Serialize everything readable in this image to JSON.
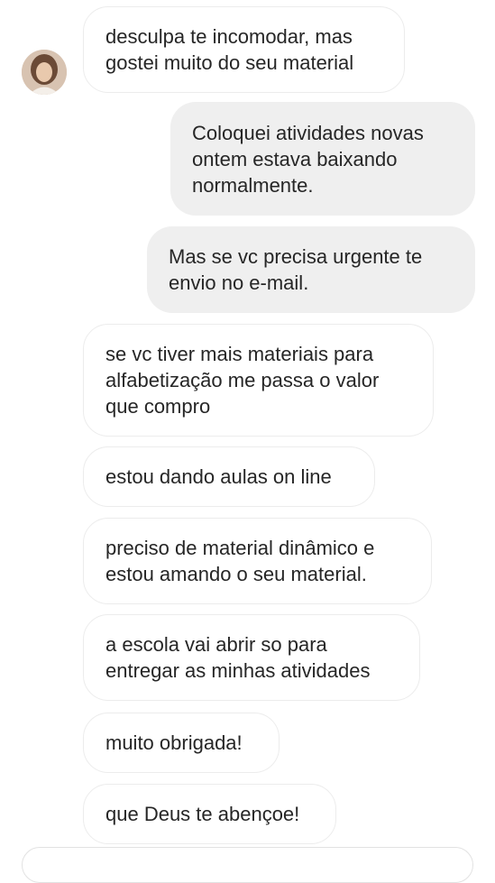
{
  "messages": [
    {
      "id": "m1",
      "direction": "incoming",
      "text": "desculpa te incomodar, mas\ngostei muito do seu material"
    },
    {
      "id": "m2",
      "direction": "outgoing",
      "text": "Coloquei atividades novas\nontem estava baixando\nnormalmente."
    },
    {
      "id": "m3",
      "direction": "outgoing",
      "text": "Mas se vc precisa urgente te\nenvio no e-mail."
    },
    {
      "id": "m4",
      "direction": "incoming",
      "text": "se vc tiver mais materiais para\nalfabetização me passa o valor\nque compro"
    },
    {
      "id": "m5",
      "direction": "incoming",
      "text": "estou dando aulas on line"
    },
    {
      "id": "m6",
      "direction": "incoming",
      "text": "preciso de material dinâmico e\nestou amando o seu material."
    },
    {
      "id": "m7",
      "direction": "incoming",
      "text": "a escola vai abrir so para\nentregar as minhas atividades"
    },
    {
      "id": "m8",
      "direction": "incoming",
      "text": "muito obrigada!"
    },
    {
      "id": "m9",
      "direction": "incoming",
      "text": "que Deus te abençoe!"
    }
  ],
  "avatar": {
    "icon": "contact-avatar-icon"
  },
  "colors": {
    "incoming_bubble": "#ffffff",
    "incoming_border": "#ececec",
    "outgoing_bubble": "#efefef",
    "text": "#262626"
  }
}
